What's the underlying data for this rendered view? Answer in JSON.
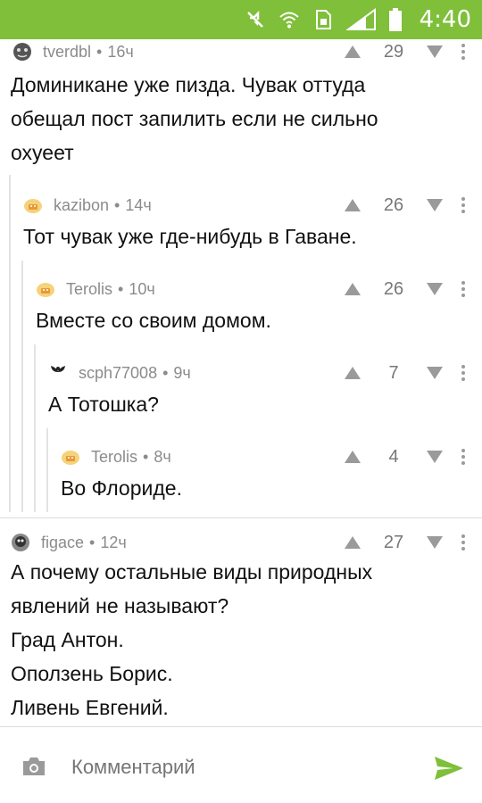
{
  "status_bar": {
    "time": "4:40"
  },
  "comments": [
    {
      "author": "tverdbl",
      "age": "16ч",
      "score": "29",
      "lines": [
        "Доминикане уже пизда. Чувак оттуда",
        "обещал пост запилить если не сильно",
        "охуеет"
      ]
    },
    {
      "author": "kazibon",
      "age": "14ч",
      "score": "26",
      "lines": [
        "Тот чувак уже где-нибудь в Гаване."
      ]
    },
    {
      "author": "Terolis",
      "age": "10ч",
      "score": "26",
      "lines": [
        "Вместе со своим домом."
      ]
    },
    {
      "author": "scph77008",
      "age": "9ч",
      "score": "7",
      "lines": [
        "А Тотошка?"
      ]
    },
    {
      "author": "Terolis",
      "age": "8ч",
      "score": "4",
      "lines": [
        "Во Флориде."
      ]
    },
    {
      "author": "figace",
      "age": "12ч",
      "score": "27",
      "lines": [
        "А почему остальные виды природных",
        "явлений не называют?",
        "Град Антон.",
        "Оползень Борис.",
        "Ливень Евгений."
      ]
    }
  ],
  "composer": {
    "placeholder": "Комментарий"
  },
  "colors": {
    "status_bar": "#7fbf3a",
    "send_icon": "#7fbf3a",
    "meta_text": "#8b8b8b"
  }
}
